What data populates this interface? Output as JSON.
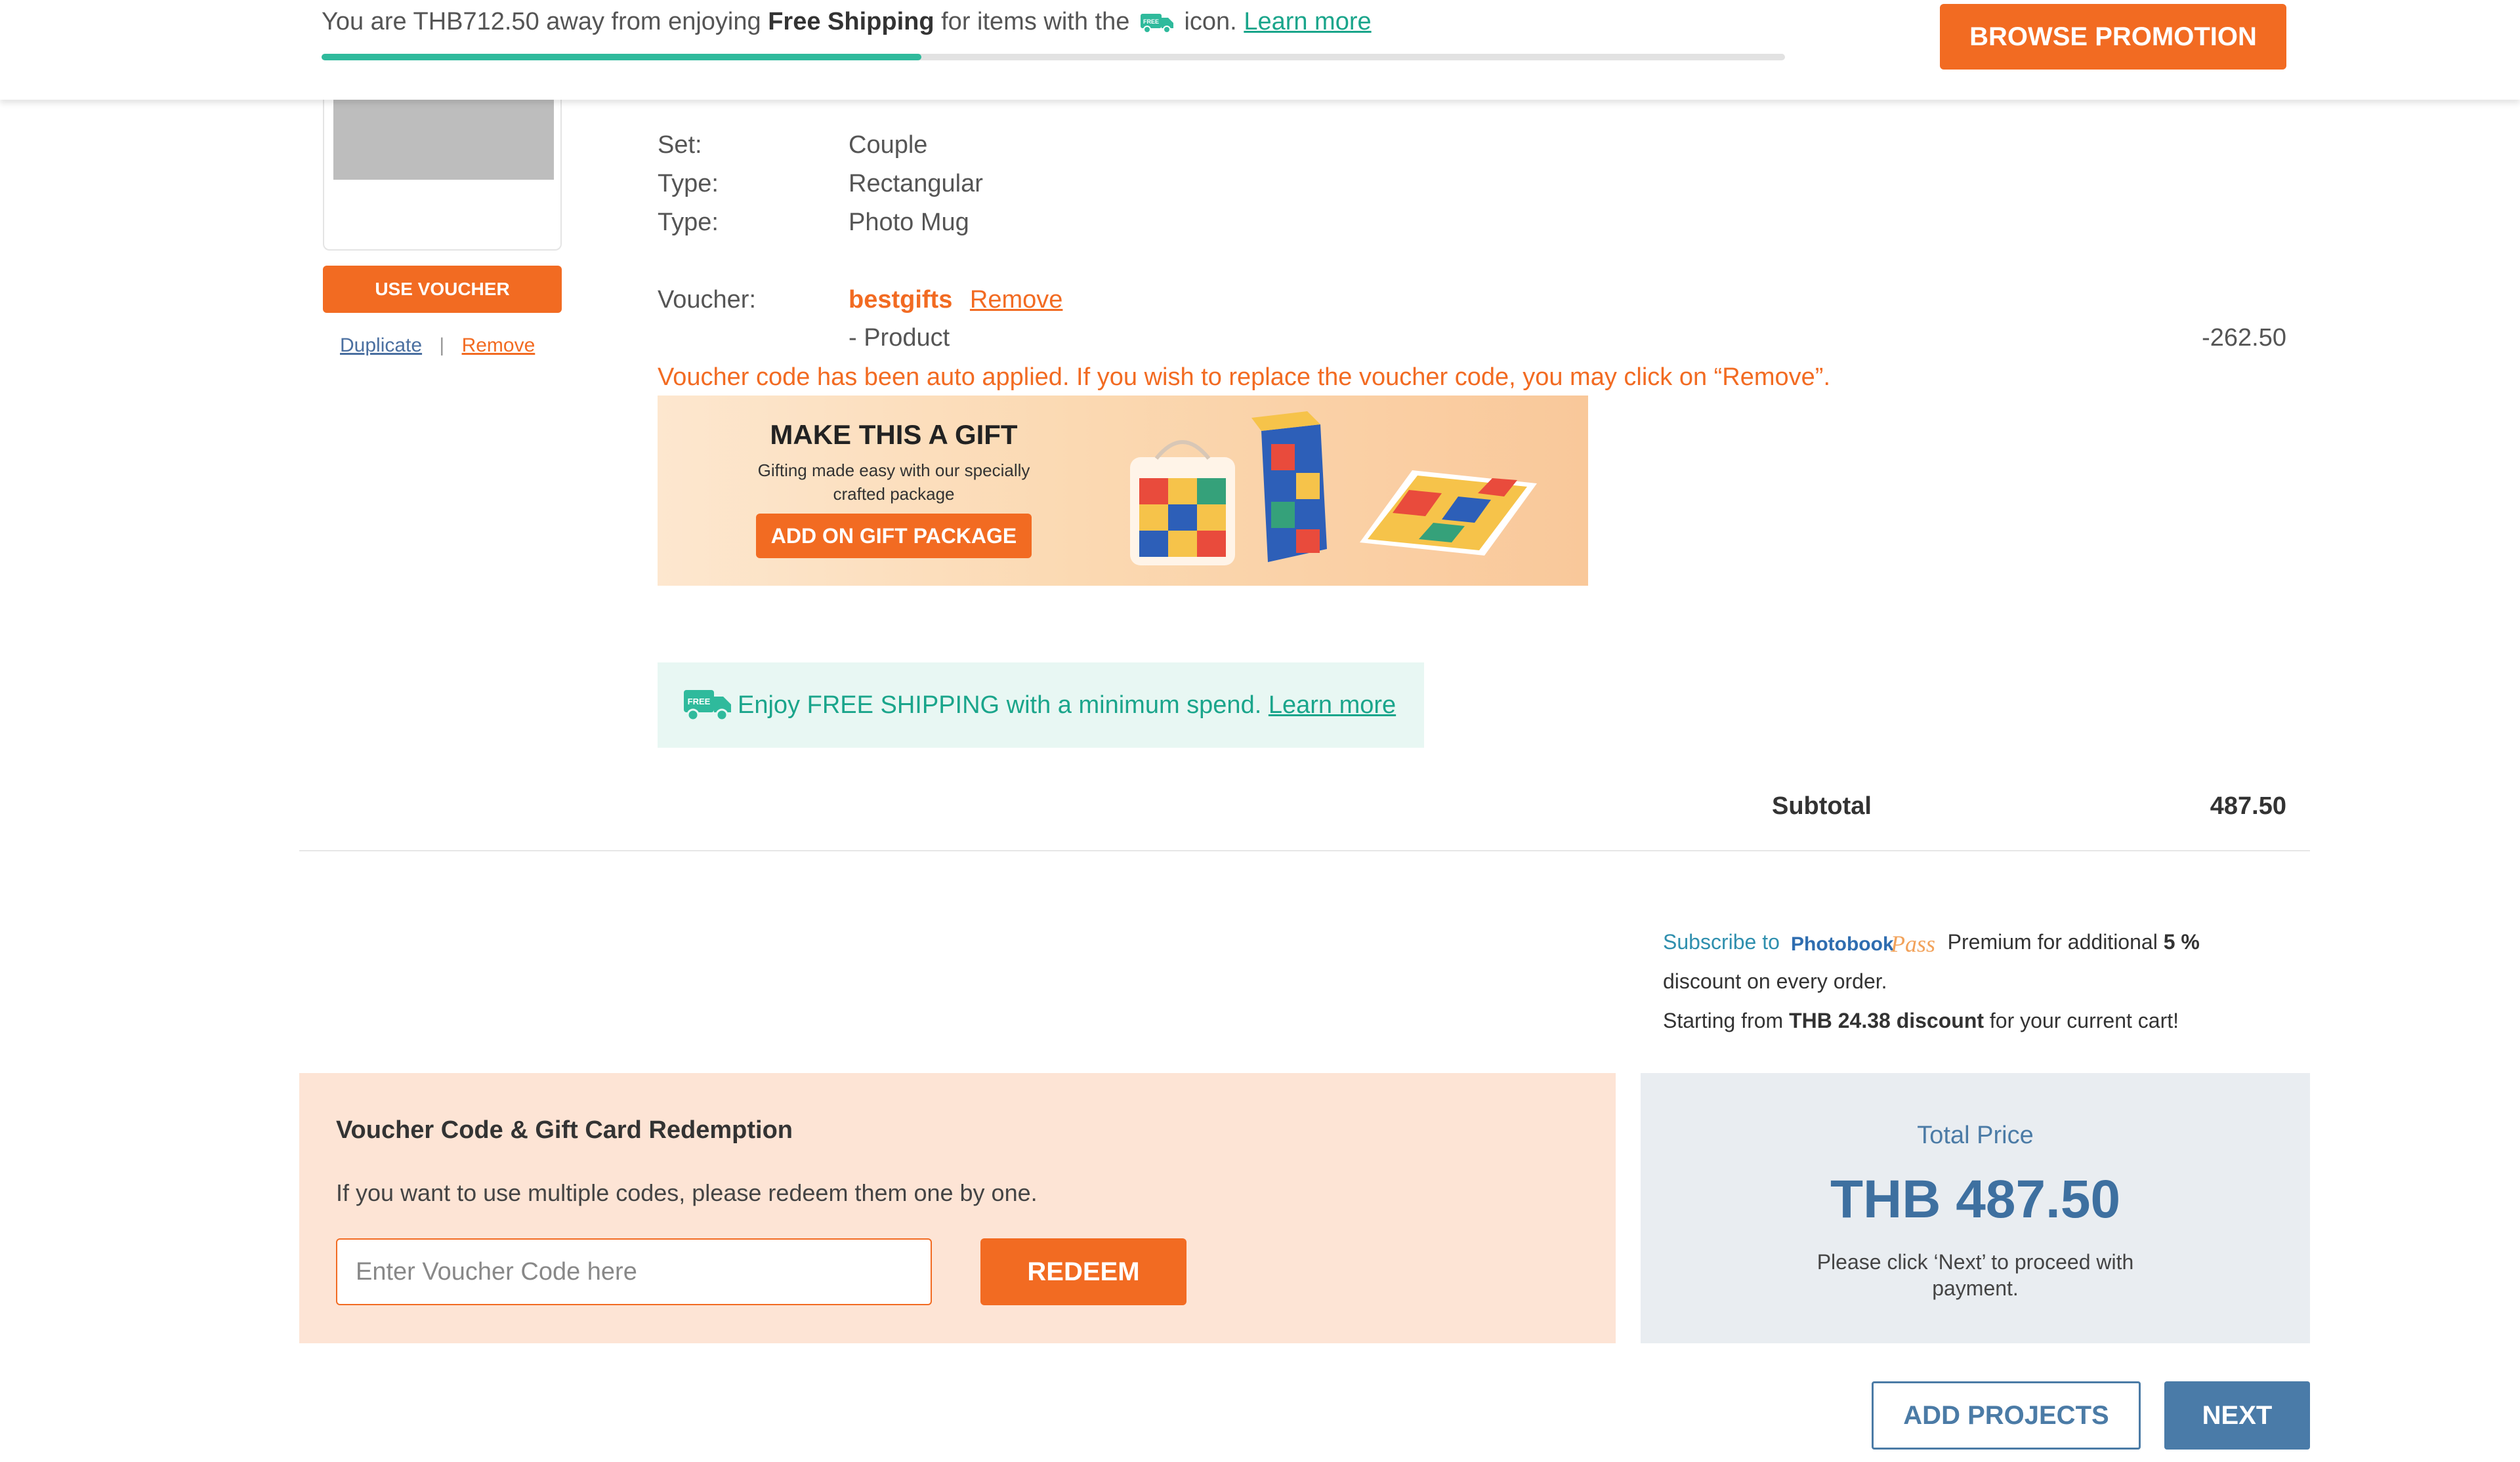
{
  "shipping_bar": {
    "msg_prefix": "You are THB712.50 away from enjoying",
    "msg_bold": "Free Shipping",
    "msg_mid": "for items with the",
    "msg_suffix": "icon.",
    "learn_more": "Learn more",
    "progress_fraction": 0.41,
    "browse_label": "BROWSE PROMOTION"
  },
  "item": {
    "use_voucher": "USE VOUCHER",
    "duplicate": "Duplicate",
    "separator": "|",
    "remove": "Remove",
    "attributes": [
      {
        "label": "Set:",
        "value": "Couple"
      },
      {
        "label": "Type:",
        "value": "Rectangular"
      },
      {
        "label": "Type:",
        "value": "Photo Mug"
      }
    ],
    "voucher_label": "Voucher:",
    "voucher_code": "bestgifts",
    "voucher_remove": "Remove",
    "voucher_product": "- Product",
    "voucher_amount": "-262.50",
    "voucher_notice": "Voucher code has been auto applied. If you wish to replace the voucher code, you may click on “Remove”."
  },
  "gift_banner": {
    "title": "MAKE THIS A GIFT",
    "subtitle": "Gifting made easy with our specially crafted package",
    "button": "ADD ON GIFT PACKAGE"
  },
  "free_shipping": {
    "icon": "free-shipping-truck-icon",
    "text": "Enjoy FREE SHIPPING with a minimum spend.",
    "link": "Learn more"
  },
  "subtotal": {
    "label": "Subtotal",
    "value": "487.50"
  },
  "photobook_pass": {
    "subscribe": "Subscribe to",
    "logo_text": "Photobook",
    "logo_script": "Pass",
    "premium": "Premium for additional",
    "percent": "5 %",
    "discount_line": "discount on every order.",
    "starting": "Starting from",
    "amount": "THB 24.38 discount",
    "cart": "for your current cart!"
  },
  "voucher_redemption": {
    "title": "Voucher Code & Gift Card Redemption",
    "subtitle": "If you want to use multiple codes, please redeem them one by one.",
    "placeholder": "Enter Voucher Code here",
    "button": "REDEEM"
  },
  "total": {
    "label": "Total Price",
    "price": "THB 487.50",
    "note": "Please click ‘Next’ to proceed with payment."
  },
  "actions": {
    "add_projects": "ADD PROJECTS",
    "next": "NEXT"
  },
  "colors": {
    "accent_orange": "#f26b22",
    "teal": "#2fba9c",
    "blue": "#4a7ba8"
  }
}
